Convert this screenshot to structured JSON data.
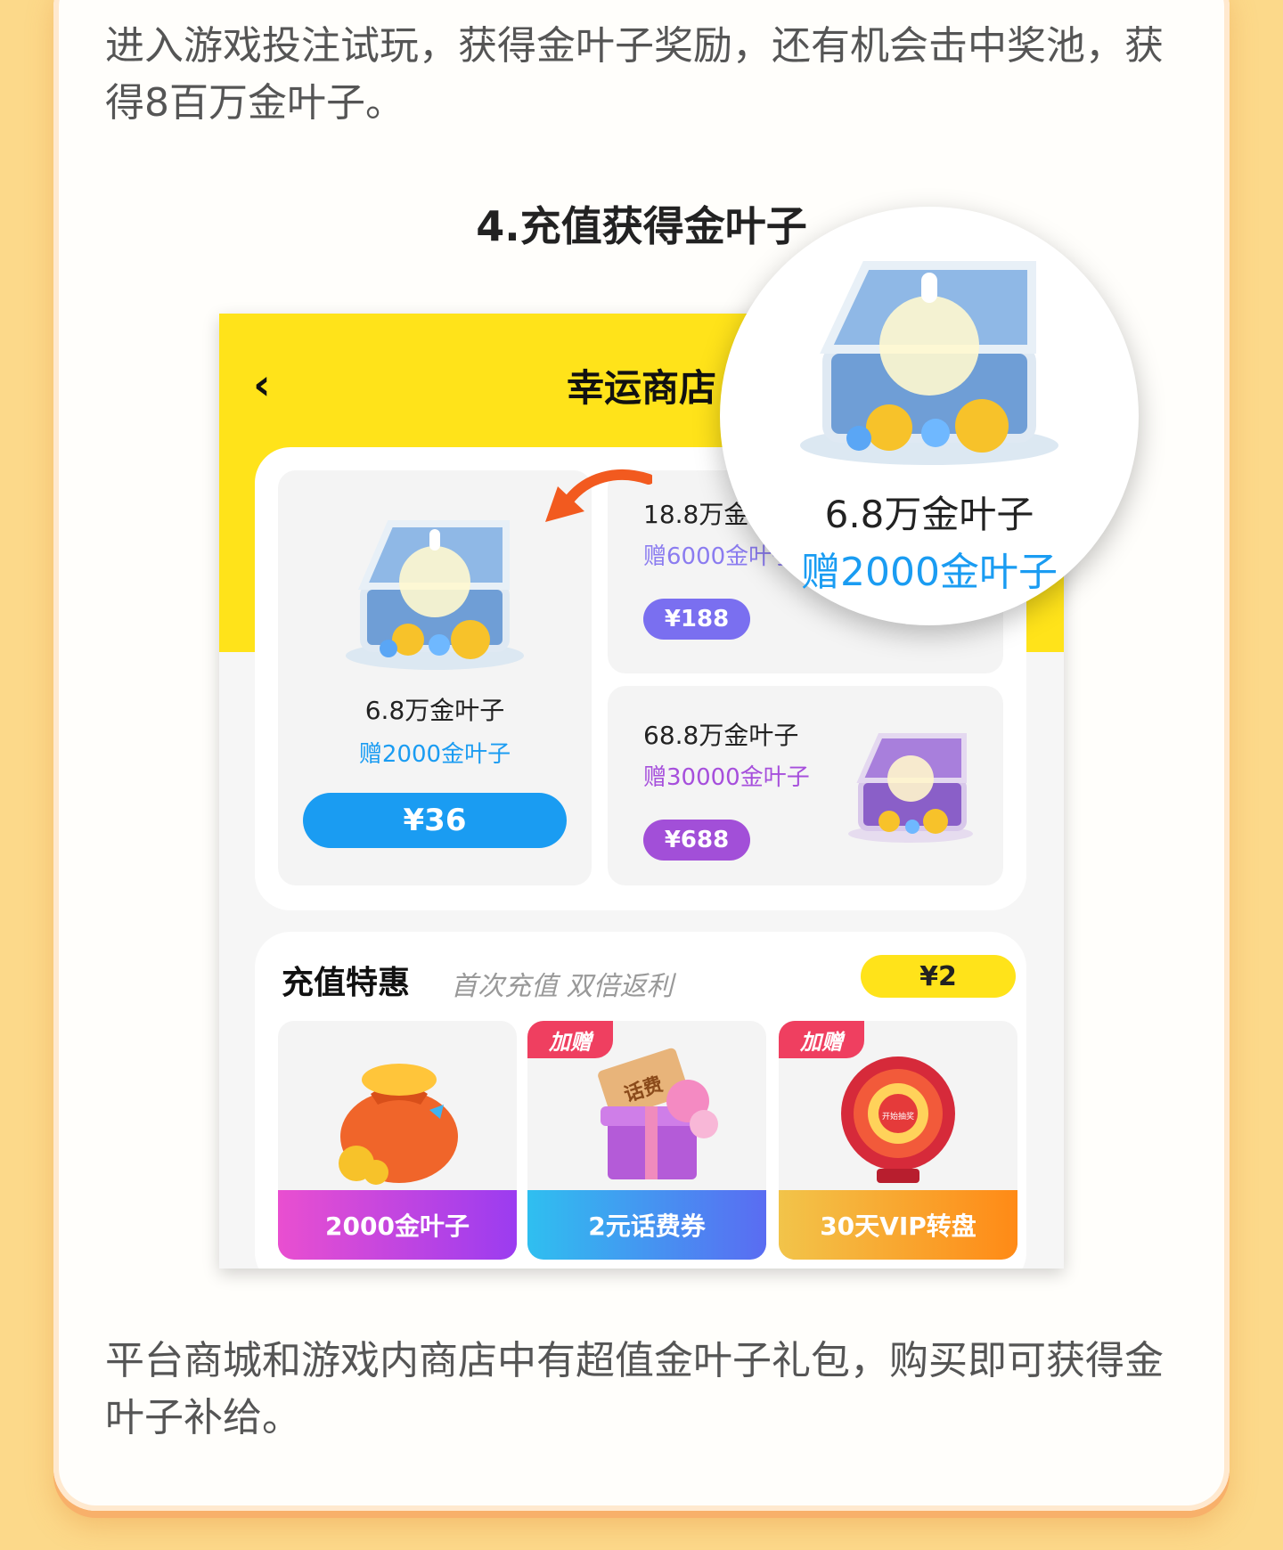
{
  "intro_text": "进入游戏投注试玩，获得金叶子奖励，还有机会击中奖池，获得8百万金叶子。",
  "section_title": "4.充值获得金叶子",
  "app": {
    "back_icon": "chevron-left-icon",
    "title": "幸运商店",
    "packages": [
      {
        "name": "6.8万金叶子",
        "bonus": "赠2000金叶子",
        "price": "¥36",
        "icon": "treasure-chest-blue-icon",
        "color": "#1a9cf2"
      },
      {
        "name": "18.8万金叶子",
        "bonus": "赠6000金叶子",
        "price": "¥188",
        "color": "#7a6ff0"
      },
      {
        "name": "68.8万金叶子",
        "bonus": "赠30000金叶子",
        "price": "¥688",
        "icon": "treasure-chest-purple-icon",
        "color": "#a24fd8"
      }
    ],
    "offers": {
      "title": "充值特惠",
      "subtitle": "首次充值 双倍返利",
      "price": "¥2",
      "items": [
        {
          "label": "2000金叶子",
          "icon": "coin-bag-icon",
          "badge": ""
        },
        {
          "label": "2元话费券",
          "icon": "gift-box-icon",
          "badge": "加赠",
          "art_text": "话费"
        },
        {
          "label": "30天VIP转盘",
          "icon": "prize-wheel-icon",
          "badge": "加赠",
          "art_text": "开始抽奖"
        }
      ]
    }
  },
  "zoom": {
    "name": "6.8万金叶子",
    "bonus": "赠2000金叶子",
    "icon": "treasure-chest-blue-icon"
  },
  "bottom_text": "平台商城和游戏内商店中有超值金叶子礼包，购买即可获得金叶子补给。",
  "colors": {
    "accent_yellow": "#ffe31a",
    "blue": "#1a9cf2",
    "arrow": "#f25a1f"
  }
}
